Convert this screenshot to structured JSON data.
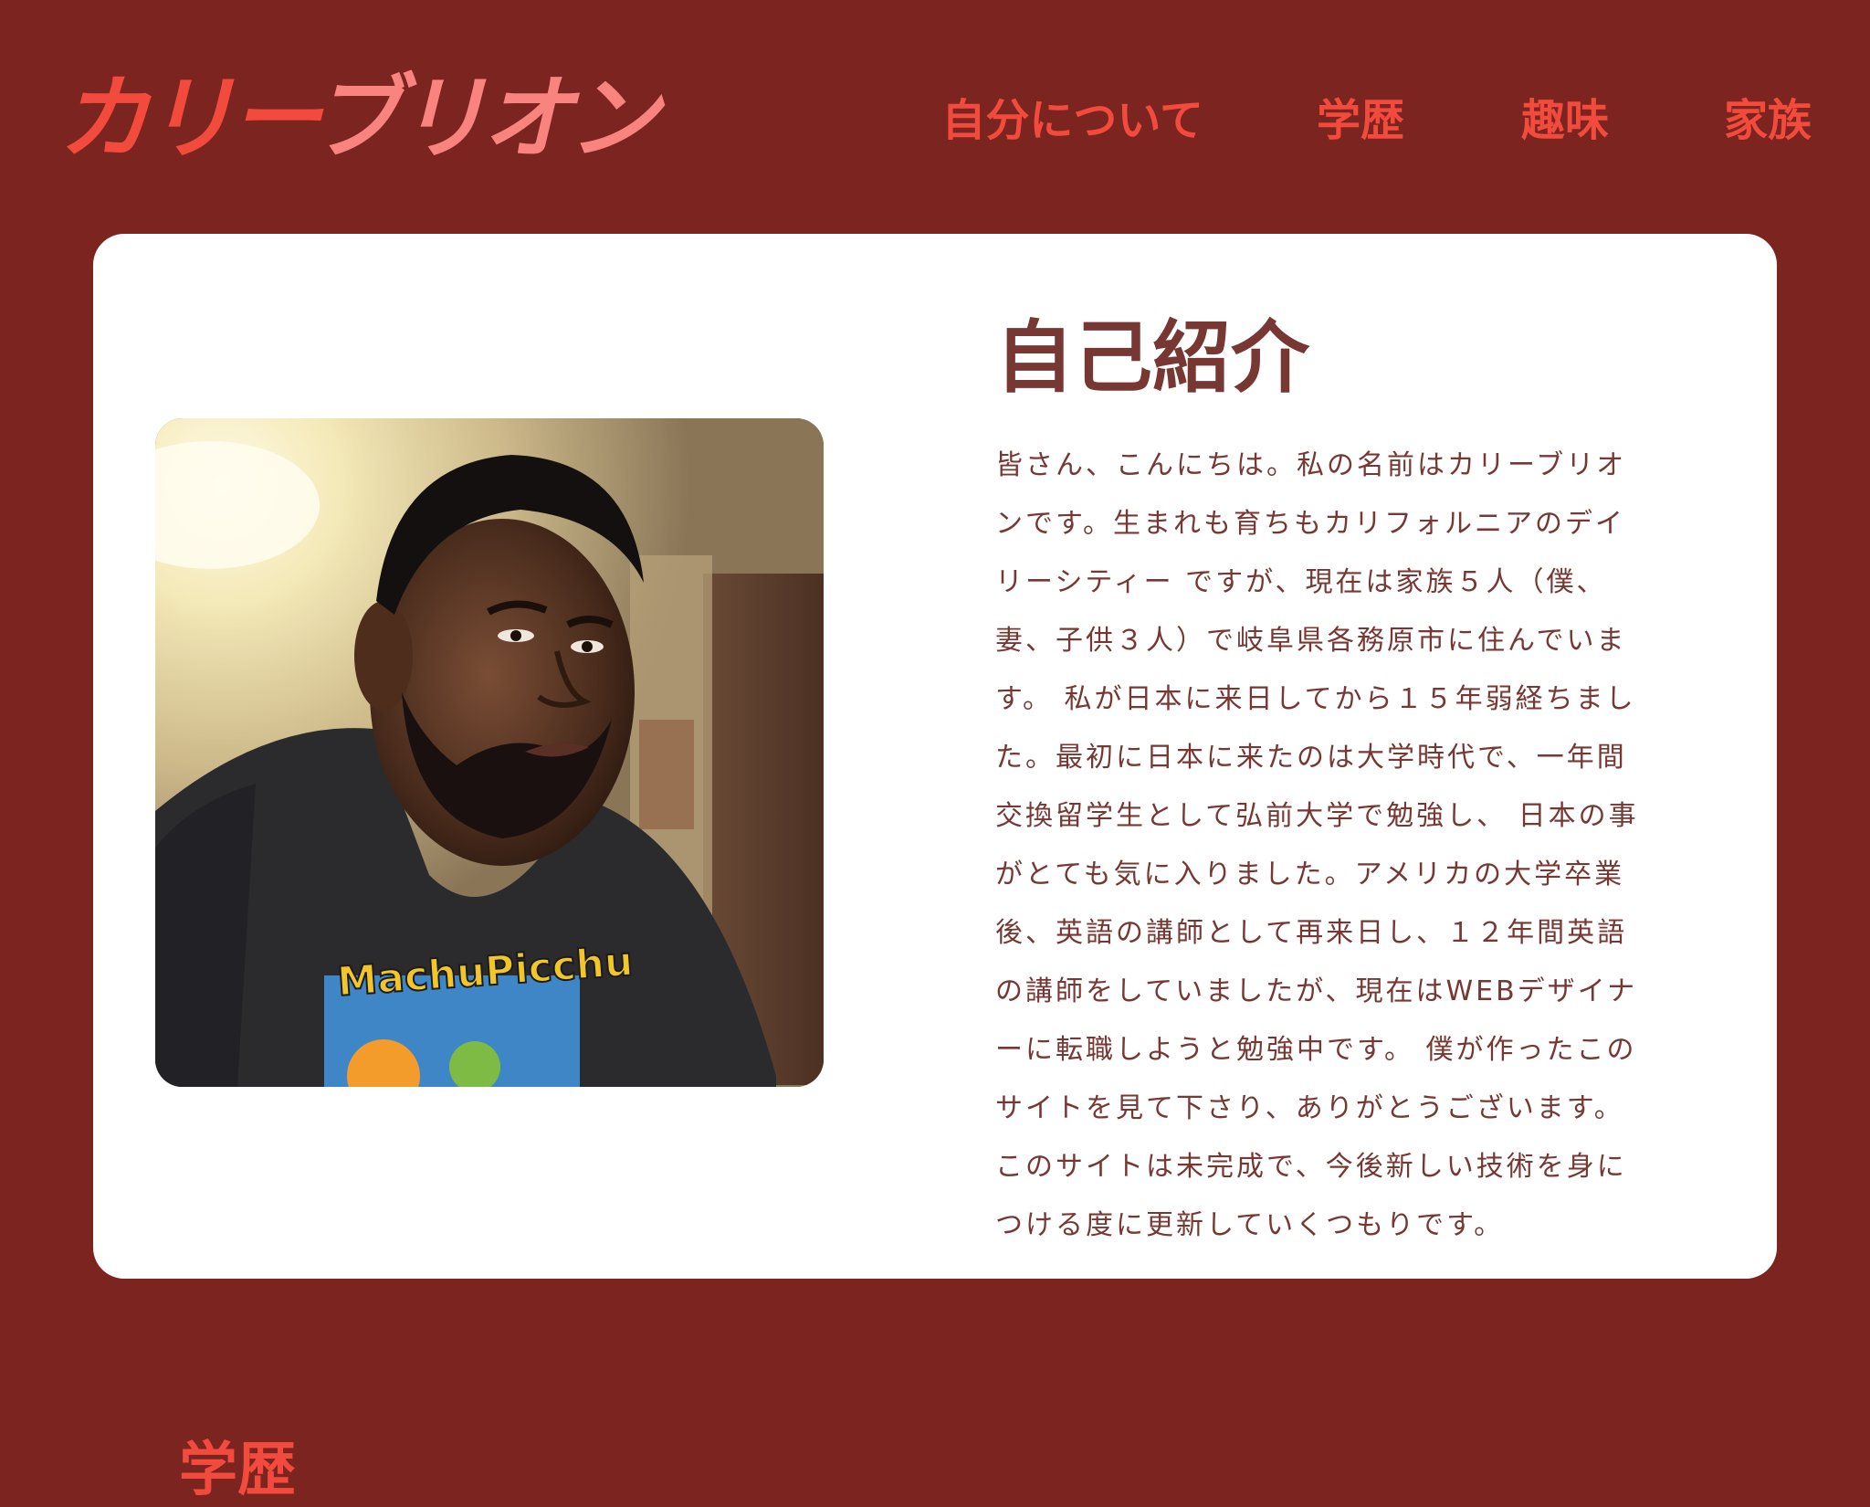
{
  "header": {
    "logo_part1": "カリー",
    "logo_part2": "ブリオン",
    "nav": [
      {
        "label": "自分について"
      },
      {
        "label": "学歴"
      },
      {
        "label": "趣味"
      },
      {
        "label": "家族"
      }
    ]
  },
  "about": {
    "title": "自己紹介",
    "photo_shirt_text": "MachuPicchu",
    "body": "皆さん、こんにちは。私の名前はカリーブリオンです。生まれも育ちもカリフォルニアのデイリーシティー ですが、現在は家族５人（僕、妻、子供３人）で岐阜県各務原市に住んでいます。 私が日本に来日してから１５年弱経ちました。最初に日本に来たのは大学時代で、一年間交換留学生として弘前大学で勉強し、 日本の事がとても気に入りました。アメリカの大学卒業後、英語の講師として再来日し、１２年間英語の講師をしていましたが、現在はWEBデザイナーに転職しようと勉強中です。 僕が作ったこのサイトを見て下さり、ありがとうございます。このサイトは未完成で、今後新しい技術を身につける度に更新していくつもりです。"
  },
  "next_section": {
    "title": "学歴"
  },
  "colors": {
    "background": "#7b2420",
    "accent": "#f24b3e",
    "accent_light": "#f9837f",
    "card": "#ffffff",
    "text": "#773833"
  }
}
